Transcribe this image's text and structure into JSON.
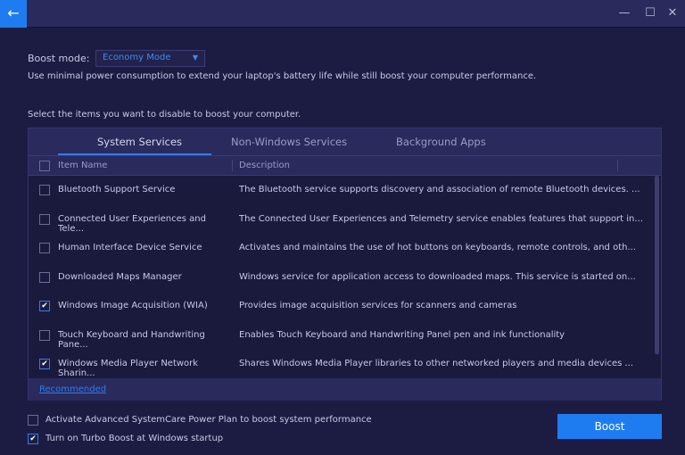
{
  "titlebar": {
    "back": "←",
    "minimize": "—",
    "maximize": "☐",
    "close": "✕"
  },
  "boost_mode": {
    "label": "Boost mode:",
    "selected": "Economy Mode",
    "caret": "▼",
    "description": "Use minimal power consumption to extend your laptop's battery life while still boost your computer performance."
  },
  "instruction": "Select the items you want to disable to boost your computer.",
  "tabs": [
    "System Services",
    "Non-Windows Services",
    "Background Apps"
  ],
  "columns": {
    "name": "Item Name",
    "description": "Description"
  },
  "rows": [
    {
      "name": "Bluetooth Support Service",
      "description": "The Bluetooth service supports discovery and association of remote Bluetooth devices. ...",
      "checked": false
    },
    {
      "name": "Connected User Experiences and Tele...",
      "description": "The Connected User Experiences and Telemetry service enables features that support in...",
      "checked": false
    },
    {
      "name": "Human Interface Device Service",
      "description": "Activates and maintains the use of hot buttons on keyboards, remote controls, and oth...",
      "checked": false
    },
    {
      "name": "Downloaded Maps Manager",
      "description": "Windows service for application access to downloaded maps. This service is started on...",
      "checked": false
    },
    {
      "name": "Windows Image Acquisition (WIA)",
      "description": "Provides image acquisition services for scanners and cameras",
      "checked": true
    },
    {
      "name": "Touch Keyboard and Handwriting Pane...",
      "description": "Enables Touch Keyboard and Handwriting Panel pen and ink functionality",
      "checked": false
    },
    {
      "name": "Windows Media Player Network Sharin...",
      "description": "Shares Windows Media Player libraries to other networked players and media devices ...",
      "checked": true
    }
  ],
  "recommended": "Recommended",
  "options": [
    {
      "label": "Activate Advanced SystemCare Power Plan to boost system performance",
      "checked": false
    },
    {
      "label": "Turn on Turbo Boost at Windows startup",
      "checked": true
    }
  ],
  "boost_button": "Boost",
  "check_glyph": "✔"
}
